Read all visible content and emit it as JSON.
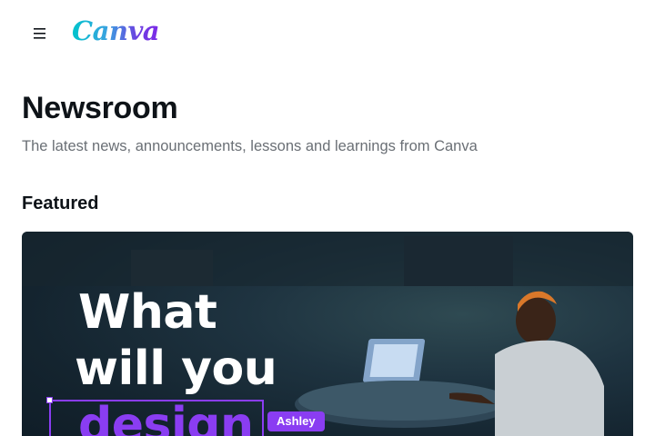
{
  "header": {
    "menu_icon": "hamburger-menu-icon",
    "logo_text": "Canva"
  },
  "main": {
    "title": "Newsroom",
    "subtitle": "The latest news, announcements, lessons and learnings from Canva",
    "featured_heading": "Featured"
  },
  "featured": {
    "hero_line_1": "What",
    "hero_line_2": "will you",
    "hero_line_3": "design",
    "collaborator_tag": "Ashley"
  },
  "colors": {
    "logo_gradient_start": "#00c4cc",
    "logo_gradient_end": "#7d2ae8",
    "accent_purple": "#8a3df2",
    "subtitle_gray": "#6a6f75"
  }
}
